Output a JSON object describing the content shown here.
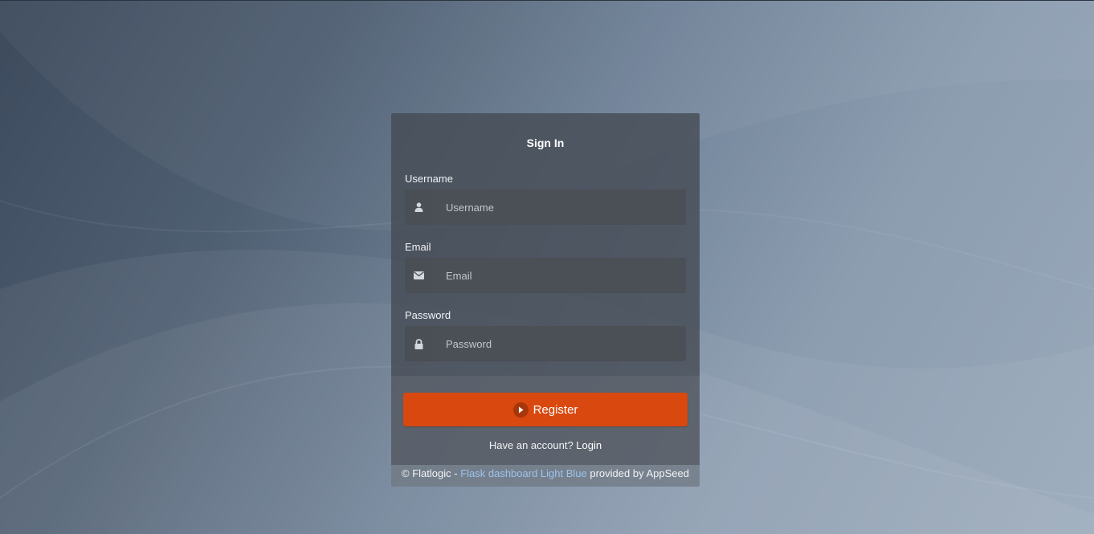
{
  "form": {
    "title": "Sign In",
    "username": {
      "label": "Username",
      "placeholder": "Username",
      "value": "",
      "icon": "user-icon"
    },
    "email": {
      "label": "Email",
      "placeholder": "Email",
      "value": "",
      "icon": "envelope-icon"
    },
    "password": {
      "label": "Password",
      "placeholder": "Password",
      "value": "",
      "icon": "lock-icon"
    },
    "register_label": "Register",
    "register_icon": "play-circle-icon",
    "have_account_text": "Have an account?",
    "login_link": "Login"
  },
  "footer": {
    "prefix": "© Flatlogic -",
    "link_text": "Flask dashboard Light Blue",
    "suffix": "provided by AppSeed"
  },
  "colors": {
    "accent": "#d9480f",
    "link": "#9cc3ea",
    "card": "#464c56"
  }
}
